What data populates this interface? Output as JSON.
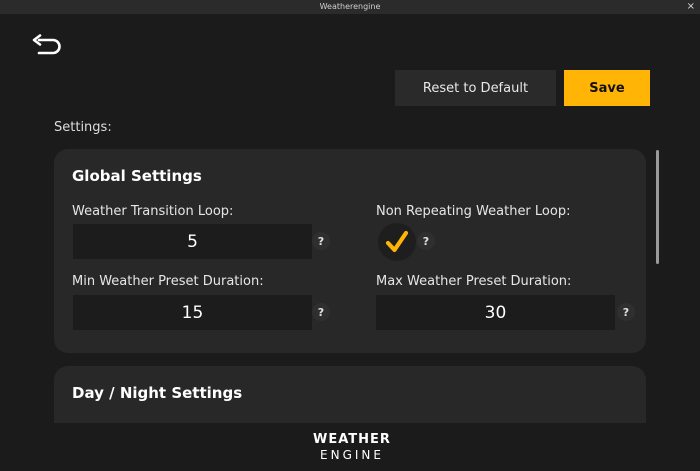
{
  "window": {
    "title": "Weatherengine",
    "close_glyph": "×"
  },
  "toolbar": {
    "back_icon": "back-arrow-icon",
    "reset_label": "Reset to Default",
    "save_label": "Save"
  },
  "page": {
    "settings_label": "Settings:"
  },
  "global": {
    "title": "Global Settings",
    "transition_loop": {
      "label": "Weather Transition Loop:",
      "value": "5"
    },
    "non_repeating": {
      "label": "Non Repeating Weather Loop:",
      "checked": true
    },
    "min_duration": {
      "label": "Min Weather Preset Duration:",
      "value": "15"
    },
    "max_duration": {
      "label": "Max Weather Preset Duration:",
      "value": "30"
    },
    "help_glyph": "?"
  },
  "day_night": {
    "title": "Day / Night Settings"
  },
  "logo": {
    "line1": "WEATHER",
    "line2": "ENGINE"
  },
  "colors": {
    "accent": "#ffb406",
    "background": "#1b1b1b",
    "card": "#282828",
    "input": "#1c1c1c"
  }
}
